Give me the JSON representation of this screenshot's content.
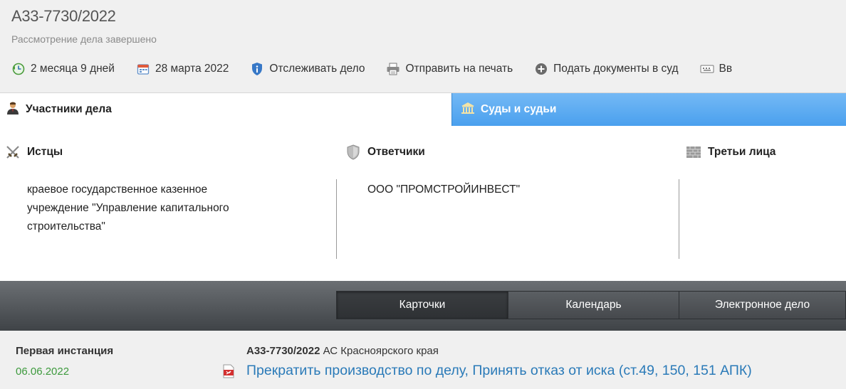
{
  "header": {
    "case_number": "А33-7730/2022",
    "status": "Рассмотрение дела завершено",
    "toolbar": {
      "duration": "2 месяца 9 дней",
      "date": "28 марта 2022",
      "track": "Отслеживать дело",
      "print": "Отправить на печать",
      "submit": "Подать документы в суд",
      "more": "Вв"
    }
  },
  "tabs": {
    "participants": "Участники дела",
    "courts": "Суды и судьи"
  },
  "parties": {
    "plaintiffs": {
      "title": "Истцы",
      "lines": [
        "краевое государственное казенное",
        "учреждение \"Управление капитального",
        "строительства\""
      ]
    },
    "defendants": {
      "title": "Ответчики",
      "name": "ООО \"ПРОМСТРОЙИНВЕСТ\""
    },
    "third_parties": {
      "title": "Третьи лица"
    }
  },
  "view_tabs": {
    "cards": "Карточки",
    "calendar": "Календарь",
    "electronic": "Электронное дело"
  },
  "instance": {
    "title": "Первая инстанция",
    "date": "06.06.2022",
    "case_ref": "А33-7730/2022",
    "court": "АС Красноярского края",
    "decision": "Прекратить производство по делу, Принять отказ от иска (ст.49, 150, 151 АПК)"
  },
  "colors": {
    "accent_blue": "#4aa0ee",
    "link_blue": "#2a7ab8",
    "date_green": "#3d9a3d",
    "dark_bar": "#3f4347"
  }
}
